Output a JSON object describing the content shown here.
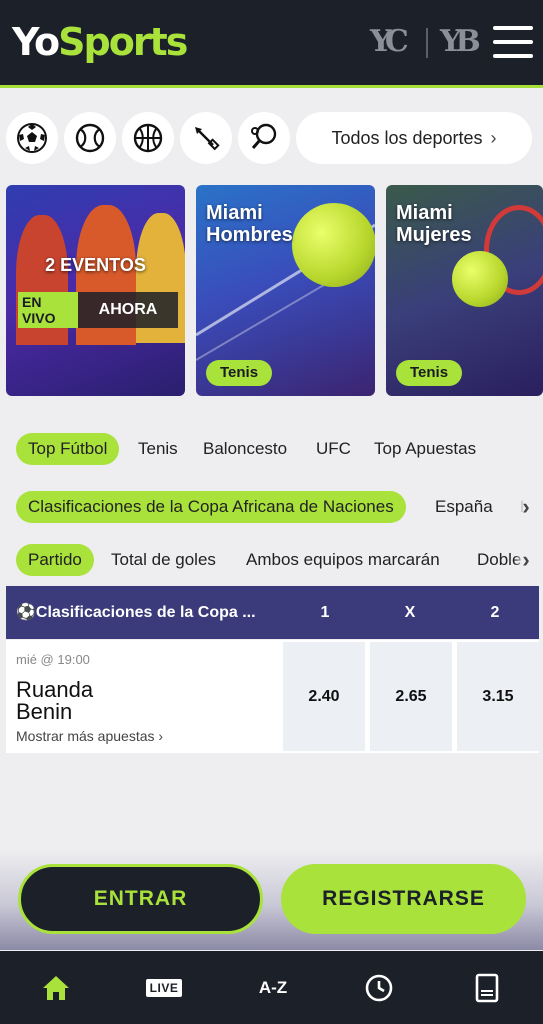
{
  "header": {
    "logo_yo": "Yo",
    "logo_sports": "Sports",
    "brand_left": "YC",
    "brand_right": "YB"
  },
  "sports_filter": {
    "icons": [
      "soccer-ball-icon",
      "tennis-ball-icon",
      "basketball-icon",
      "darts-icon",
      "table-tennis-icon"
    ],
    "all_sports_label": "Todos los deportes"
  },
  "event_cards": [
    {
      "count": "2 EVENTOS",
      "live_label": "EN VIVO",
      "now_label": "AHORA"
    },
    {
      "title": "Miami Hombres",
      "tag": "Tenis"
    },
    {
      "title": "Miami Mujeres",
      "tag": "Tenis"
    }
  ],
  "top_tabs": [
    "Top Fútbol",
    "Tenis",
    "Baloncesto",
    "UFC",
    "Top Apuestas"
  ],
  "league_tabs": [
    "Clasificaciones de la Copa Africana de Naciones",
    "España",
    "Fr"
  ],
  "market_tabs": [
    "Partido",
    "Total de goles",
    "Ambos equipos marcarán",
    "Doble"
  ],
  "market": {
    "league": "Clasificaciones de la Copa ...",
    "columns": [
      "1",
      "X",
      "2"
    ],
    "match": {
      "time": "mié @ 19:00",
      "home": "Ruanda",
      "away": "Benin",
      "more_label": "Mostrar más apuestas",
      "odds": [
        "2.40",
        "2.65",
        "3.15"
      ]
    }
  },
  "auth": {
    "login": "ENTRAR",
    "register": "REGISTRARSE"
  },
  "bottom_nav": {
    "live": "LIVE",
    "az": "A-Z"
  },
  "colors": {
    "accent": "#a9e23b",
    "dark": "#1c2029",
    "market_header": "#3b3a7a"
  }
}
